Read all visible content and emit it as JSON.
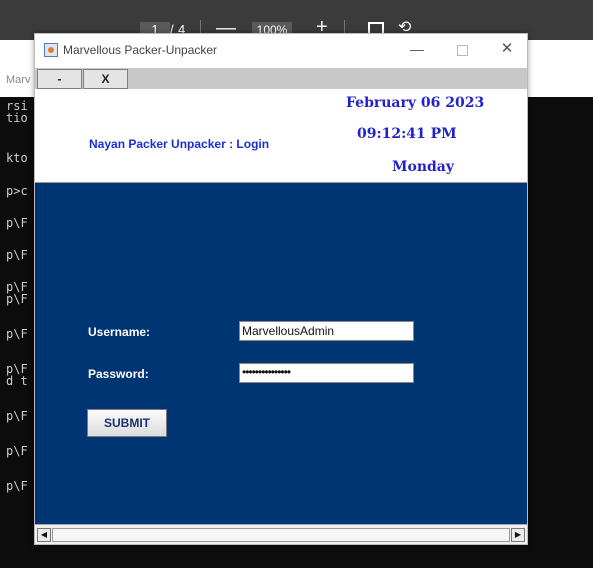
{
  "pdf_viewer": {
    "page": "1",
    "separator": "/",
    "total_pages": "4",
    "zoom": "100%",
    "minus_label": "—",
    "plus_label": "+"
  },
  "background": {
    "tab_text": "Marv",
    "console_lines": [
      "rsi",
      "tio",
      "kto",
      "p>c",
      "p\\F",
      "p\\F",
      "p\\F",
      "p\\F",
      "p\\F",
      "p\\F",
      "d t",
      "p\\F",
      "p\\F",
      "p\\F"
    ]
  },
  "window": {
    "title": "Marvellous Packer-Unpacker",
    "minimize_label": "—",
    "close_label": "✕"
  },
  "menubar": {
    "minus_label": "-",
    "close_label": "X"
  },
  "header": {
    "app_title": "Nayan Packer Unpacker : Login",
    "date": "February 06 2023",
    "time": "09:12:41 PM",
    "day": "Monday"
  },
  "form": {
    "username_label": "Username:",
    "username_value": "MarvellousAdmin",
    "password_label": "Password:",
    "password_mask": "•••••••••••••••",
    "submit_label": "SUBMIT"
  },
  "scrollbar": {
    "left_arrow": "◀",
    "right_arrow": "▶"
  },
  "colors": {
    "content_bg": "#003574",
    "header_text": "#2222cc",
    "console_bg": "#0c0c0c"
  }
}
